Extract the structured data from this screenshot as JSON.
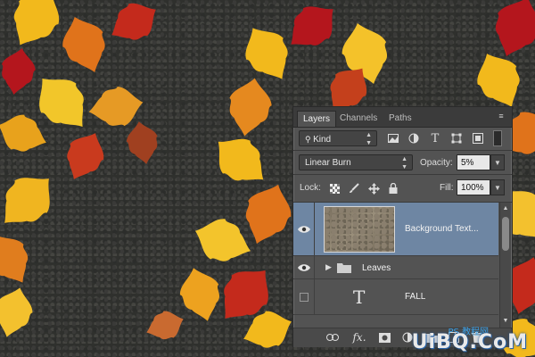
{
  "panel": {
    "tabs": [
      {
        "label": "Layers",
        "active": true
      },
      {
        "label": "Channels",
        "active": false
      },
      {
        "label": "Paths",
        "active": false
      }
    ],
    "filter": {
      "value": "Kind",
      "icons": [
        "image-filter-icon",
        "adjustment-filter-icon",
        "type-filter-icon",
        "shape-filter-icon",
        "smart-object-filter-icon",
        "filter-toggle-icon"
      ]
    },
    "blend": {
      "mode": "Linear Burn",
      "opacity_label": "Opacity:",
      "opacity_value": "5%"
    },
    "lock": {
      "label": "Lock:",
      "fill_label": "Fill:",
      "fill_value": "100%",
      "icons": [
        "lock-transparent-icon",
        "lock-image-icon",
        "lock-position-icon",
        "lock-all-icon"
      ]
    },
    "layers": [
      {
        "name": "Background Text...",
        "visible": true,
        "selected": true,
        "kind": "smart-object"
      },
      {
        "name": "Leaves",
        "visible": true,
        "selected": false,
        "kind": "group"
      },
      {
        "name": "FALL",
        "visible": false,
        "selected": false,
        "kind": "type"
      }
    ],
    "footer_icons": [
      "link-icon",
      "fx-icon",
      "mask-icon",
      "adjustment-layer-icon",
      "new-group-icon",
      "new-layer-icon",
      "trash-icon"
    ],
    "footer_fx_label": "fx."
  },
  "watermark": {
    "text": "UiBQ.CoM",
    "sub": "PS 教程网"
  },
  "colors": {
    "panel": "#535353",
    "selection": "#6e86a3",
    "leaf_yellow": "#f2b91c",
    "leaf_orange": "#e0731b",
    "leaf_red": "#b4161d"
  }
}
